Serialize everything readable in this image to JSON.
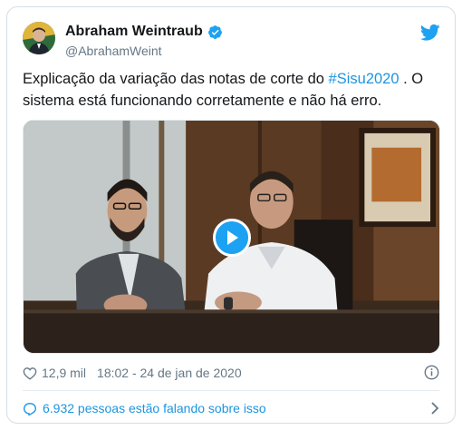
{
  "author": {
    "display_name": "Abraham Weintraub",
    "handle": "@AbrahamWeint",
    "verified": true
  },
  "tweet": {
    "text_before": "Explicação da variação das notas de corte do ",
    "hashtag": "#Sisu2020",
    "text_after": " . O sistema está funcionando corretamente e não há erro."
  },
  "meta": {
    "likes": "12,9 mil",
    "timestamp": "18:02 - 24 de jan de 2020"
  },
  "conversation": {
    "label": "6.932 pessoas estão falando sobre isso"
  },
  "colors": {
    "accent": "#1da1f2",
    "link": "#1b95e0",
    "secondary_text": "#657786"
  },
  "icons": [
    "twitter-logo",
    "verified-badge",
    "play-icon",
    "heart-icon",
    "info-icon",
    "speech-bubble-icon",
    "chevron-right-icon"
  ]
}
